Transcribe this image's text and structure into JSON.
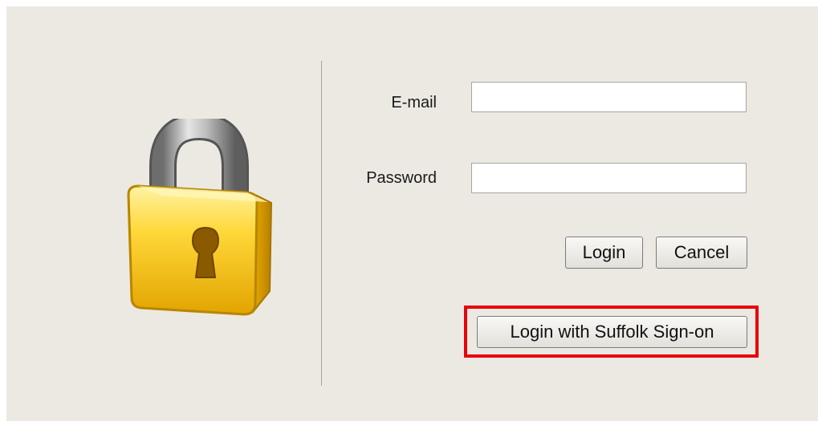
{
  "icons": {
    "lock": "padlock-icon"
  },
  "form": {
    "email_label": "E-mail",
    "email_value": "",
    "password_label": "Password",
    "password_value": ""
  },
  "buttons": {
    "login_label": "Login",
    "cancel_label": "Cancel",
    "sso_label": "Login with Suffolk Sign-on"
  },
  "colors": {
    "panel_background": "#ece9e2",
    "highlight": "#e8000b",
    "lock_body": "#f5c400"
  }
}
